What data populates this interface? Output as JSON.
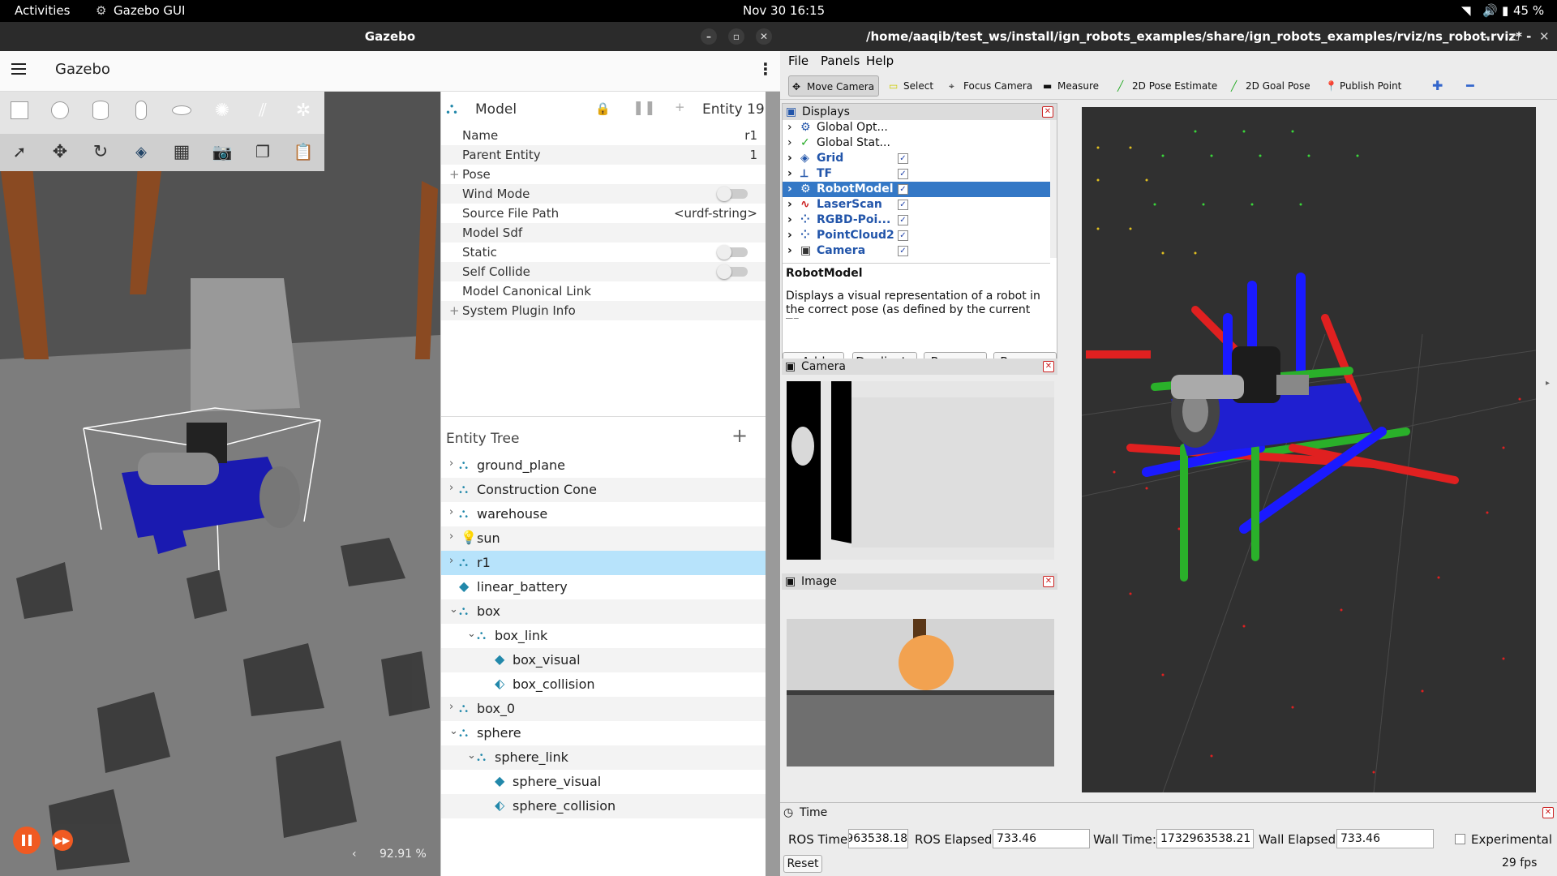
{
  "topbar": {
    "activities": "Activities",
    "app": "Gazebo GUI",
    "datetime": "Nov 30  16:15",
    "battery": "45 %"
  },
  "gazebo": {
    "window_title": "Gazebo",
    "app_name": "Gazebo",
    "zoom": "92.91 %",
    "model_panel": {
      "title": "Model",
      "entity": "Entity 19",
      "props": [
        {
          "key": "Name",
          "value": "r1"
        },
        {
          "key": "Parent Entity",
          "value": "1"
        },
        {
          "key": "Pose",
          "value": ""
        },
        {
          "key": "Wind Mode",
          "value": ""
        },
        {
          "key": "Source File Path",
          "value": "<urdf-string>"
        },
        {
          "key": "Model Sdf",
          "value": ""
        },
        {
          "key": "Static",
          "value": ""
        },
        {
          "key": "Self Collide",
          "value": ""
        },
        {
          "key": "Model Canonical Link",
          "value": ""
        },
        {
          "key": "System Plugin Info",
          "value": ""
        }
      ]
    },
    "entity_tree": {
      "title": "Entity Tree",
      "items": [
        "ground_plane",
        "Construction Cone",
        "warehouse",
        "sun",
        "r1",
        "linear_battery",
        "box",
        "box_link",
        "box_visual",
        "box_collision",
        "box_0",
        "sphere",
        "sphere_link",
        "sphere_visual",
        "sphere_collision"
      ]
    }
  },
  "rviz": {
    "window_title": "/home/aaqib/test_ws/install/ign_robots_examples/share/ign_robots_examples/rviz/ns_robot.rviz* - RViz",
    "menu": [
      "File",
      "Panels",
      "Help"
    ],
    "tools": [
      "Move Camera",
      "Select",
      "Focus Camera",
      "Measure",
      "2D Pose Estimate",
      "2D Goal Pose",
      "Publish Point"
    ],
    "displays": {
      "title": "Displays",
      "items": [
        "Global Opt...",
        "Global Stat...",
        "Grid",
        "TF",
        "RobotModel",
        "LaserScan",
        "RGBD-Poi...",
        "PointCloud2",
        "Camera"
      ],
      "desc_title": "RobotModel",
      "desc_text": "Displays a visual representation of a robot in the correct pose (as defined by the current TF",
      "buttons": [
        "Add",
        "Duplicate",
        "Remove",
        "Rename"
      ]
    },
    "camera_panel": "Camera",
    "image_panel": "Image",
    "time": {
      "title": "Time",
      "ros_time_label": "ROS Time:",
      "ros_time": "963538.18",
      "ros_elapsed_label": "ROS Elapsed:",
      "ros_elapsed": "733.46",
      "wall_time_label": "Wall Time:",
      "wall_time": "1732963538.21",
      "wall_elapsed_label": "Wall Elapsed:",
      "wall_elapsed": "733.46",
      "experimental": "Experimental",
      "reset": "Reset",
      "fps": "29 fps"
    }
  }
}
